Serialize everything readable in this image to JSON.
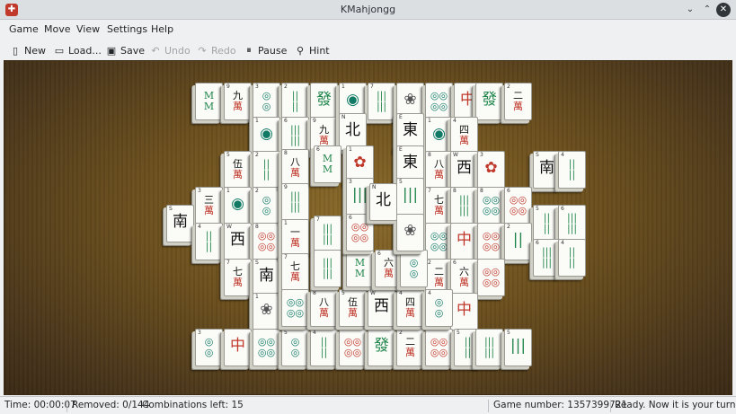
{
  "window": {
    "title": "KMahjongg",
    "app_icon_glyph": "✚",
    "controls": {
      "minimize": "⌄",
      "maximize": "⌃",
      "close": "✕"
    }
  },
  "menu": [
    "Game",
    "Move",
    "View",
    "Settings",
    "Help"
  ],
  "toolbar": {
    "new": {
      "label": "New",
      "icon": "new-document-icon",
      "glyph": "▯"
    },
    "load": {
      "label": "Load...",
      "icon": "folder-icon",
      "glyph": "▭"
    },
    "save": {
      "label": "Save",
      "icon": "save-icon",
      "glyph": "▣"
    },
    "undo": {
      "label": "Undo",
      "icon": "undo-icon",
      "glyph": "↶"
    },
    "redo": {
      "label": "Redo",
      "icon": "redo-icon",
      "glyph": "↷"
    },
    "pause": {
      "label": "Pause",
      "icon": "pause-icon",
      "glyph": "⏸"
    },
    "hint": {
      "label": "Hint",
      "icon": "hint-icon",
      "glyph": "⚲"
    }
  },
  "status": {
    "time": "Time: 00:00:07",
    "removed": "Removed: 0/144",
    "combinations": "Combinations left: 15",
    "game_number": "Game number: 1357399721",
    "message": "Ready. Now it is your turn."
  },
  "colors": {
    "char_red": "#c0392b",
    "bamboo_green": "#1e8449",
    "circle_teal": "#117a65",
    "wind_black": "#111111"
  },
  "tiles": [
    {
      "c": "",
      "f": "M\n M",
      "col": "#1e8449"
    },
    {
      "c": "9",
      "f": "九\n萬",
      "col": "#111"
    },
    {
      "c": "3",
      "f": "◎\n ◎",
      "col": "#117a65"
    },
    {
      "c": "2",
      "f": "||\n||",
      "col": "#1e8449"
    },
    {
      "c": "",
      "f": "發",
      "col": "#1e8449"
    },
    {
      "c": "1",
      "f": "◉",
      "col": "#117a65"
    },
    {
      "c": "7",
      "f": "|||\n|||",
      "col": "#1e8449"
    },
    {
      "c": "",
      "f": "❀",
      "col": "#555"
    },
    {
      "c": "",
      "f": "◎◎\n◎◎",
      "col": "#117a65"
    },
    {
      "c": "",
      "f": "中",
      "col": "#c0392b"
    },
    {
      "c": "",
      "f": "發",
      "col": "#1e8449"
    },
    {
      "c": "2",
      "f": "二\n萬",
      "col": "#111"
    },
    {
      "c": "1",
      "f": "◉",
      "col": "#117a65"
    },
    {
      "c": "6",
      "f": "|||\n|||",
      "col": "#1e8449"
    },
    {
      "c": "9",
      "f": "九\n萬",
      "col": "#111"
    },
    {
      "c": "N",
      "f": "北",
      "col": "#111"
    },
    {
      "c": "E",
      "f": "東",
      "col": "#111"
    },
    {
      "c": "1",
      "f": "◉",
      "col": "#117a65"
    },
    {
      "c": "4",
      "f": "四\n萬",
      "col": "#111"
    },
    {
      "c": "5",
      "f": "伍\n萬",
      "col": "#111"
    },
    {
      "c": "2",
      "f": "||\n||",
      "col": "#1e8449"
    },
    {
      "c": "8",
      "f": "八\n萬",
      "col": "#111"
    },
    {
      "c": "6",
      "f": "M\nM",
      "col": "#1e8449"
    },
    {
      "c": "1",
      "f": "✿",
      "col": "#c0392b"
    },
    {
      "c": "E",
      "f": "東",
      "col": "#111"
    },
    {
      "c": "8",
      "f": "八\n萬",
      "col": "#111"
    },
    {
      "c": "W",
      "f": "西",
      "col": "#111"
    },
    {
      "c": "3",
      "f": "✿",
      "col": "#c0392b"
    },
    {
      "c": "3",
      "f": "三\n萬",
      "col": "#111"
    },
    {
      "c": "1",
      "f": "◉",
      "col": "#117a65"
    },
    {
      "c": "2",
      "f": "◎\n◎",
      "col": "#117a65"
    },
    {
      "c": "9",
      "f": "|||\n|||",
      "col": "#1e8449"
    },
    {
      "c": "3",
      "f": "|||",
      "col": "#1e8449"
    },
    {
      "c": "N",
      "f": "北",
      "col": "#111"
    },
    {
      "c": "5",
      "f": "|||",
      "col": "#1e8449"
    },
    {
      "c": "7",
      "f": "七\n萬",
      "col": "#111"
    },
    {
      "c": "8",
      "f": "|||\n|||",
      "col": "#1e8449"
    },
    {
      "c": "8",
      "f": "◎◎\n◎◎",
      "col": "#117a65"
    },
    {
      "c": "6",
      "f": "◎◎\n◎◎",
      "col": "#c0392b"
    },
    {
      "c": "5",
      "f": "||\n||",
      "col": "#1e8449"
    },
    {
      "c": "6",
      "f": "|||\n|||",
      "col": "#1e8449"
    },
    {
      "c": "S",
      "f": "南",
      "col": "#111"
    },
    {
      "c": "4",
      "f": "||\n||",
      "col": "#1e8449"
    },
    {
      "c": "W",
      "f": "西",
      "col": "#111"
    },
    {
      "c": "8",
      "f": "◎◎\n◎◎",
      "col": "#c0392b"
    },
    {
      "c": "1",
      "f": "一\n萬",
      "col": "#111"
    },
    {
      "c": "7",
      "f": "|||\n|||",
      "col": "#1e8449"
    },
    {
      "c": "6",
      "f": "◎◎\n◎◎",
      "col": "#c0392b"
    },
    {
      "c": "",
      "f": "❀",
      "col": "#555"
    },
    {
      "c": "",
      "f": "◎◎\n◎◎",
      "col": "#117a65"
    },
    {
      "c": "",
      "f": "中",
      "col": "#c0392b"
    },
    {
      "c": "",
      "f": "◎◎\n◎◎",
      "col": "#c0392b"
    },
    {
      "c": "2",
      "f": "||",
      "col": "#1e8449"
    },
    {
      "c": "7",
      "f": "七\n萬",
      "col": "#111"
    },
    {
      "c": "S",
      "f": "南",
      "col": "#111"
    },
    {
      "c": "7",
      "f": "七\n萬",
      "col": "#111"
    },
    {
      "c": "",
      "f": "|||\n|||",
      "col": "#1e8449"
    },
    {
      "c": "",
      "f": "M\nM",
      "col": "#1e8449"
    },
    {
      "c": "6",
      "f": "六\n萬",
      "col": "#111"
    },
    {
      "c": "4",
      "f": "◎\n◎",
      "col": "#117a65"
    },
    {
      "c": "2",
      "f": "二\n萬",
      "col": "#111"
    },
    {
      "c": "6",
      "f": "六\n萬",
      "col": "#111"
    },
    {
      "c": "",
      "f": "◎◎\n◎◎",
      "col": "#c0392b"
    },
    {
      "c": "1",
      "f": "❀",
      "col": "#555"
    },
    {
      "c": "",
      "f": "◎◎\n◎◎",
      "col": "#117a65"
    },
    {
      "c": "8",
      "f": "八\n萬",
      "col": "#111"
    },
    {
      "c": "5",
      "f": "伍\n萬",
      "col": "#111"
    },
    {
      "c": "W",
      "f": "西",
      "col": "#111"
    },
    {
      "c": "4",
      "f": "四\n萬",
      "col": "#111"
    },
    {
      "c": "4",
      "f": "◎\n◎",
      "col": "#117a65"
    },
    {
      "c": "",
      "f": "中",
      "col": "#c0392b"
    },
    {
      "c": "3",
      "f": "◎\n◎",
      "col": "#117a65"
    },
    {
      "c": "",
      "f": "中",
      "col": "#c0392b"
    },
    {
      "c": "",
      "f": "◎◎\n◎◎",
      "col": "#117a65"
    },
    {
      "c": "5",
      "f": "◎\n◎",
      "col": "#117a65"
    },
    {
      "c": "4",
      "f": "||\n||",
      "col": "#1e8449"
    },
    {
      "c": "",
      "f": "◎◎\n◎◎",
      "col": "#c0392b"
    },
    {
      "c": "",
      "f": "發",
      "col": "#1e8449"
    },
    {
      "c": "2",
      "f": "二\n萬",
      "col": "#111"
    },
    {
      "c": "",
      "f": "◎◎\n◎◎",
      "col": "#c0392b"
    },
    {
      "c": "5",
      "f": "||\n||",
      "col": "#1e8449"
    },
    {
      "c": "",
      "f": "|||\n|||",
      "col": "#1e8449"
    },
    {
      "c": "5",
      "f": "|||",
      "col": "#1e8449"
    },
    {
      "c": "6",
      "f": "|||\n|||",
      "col": "#1e8449"
    },
    {
      "c": "4",
      "f": "||\n||",
      "col": "#1e8449"
    },
    {
      "c": "S",
      "f": "南",
      "col": "#111"
    },
    {
      "c": "4",
      "f": "||\n||",
      "col": "#1e8449"
    }
  ]
}
